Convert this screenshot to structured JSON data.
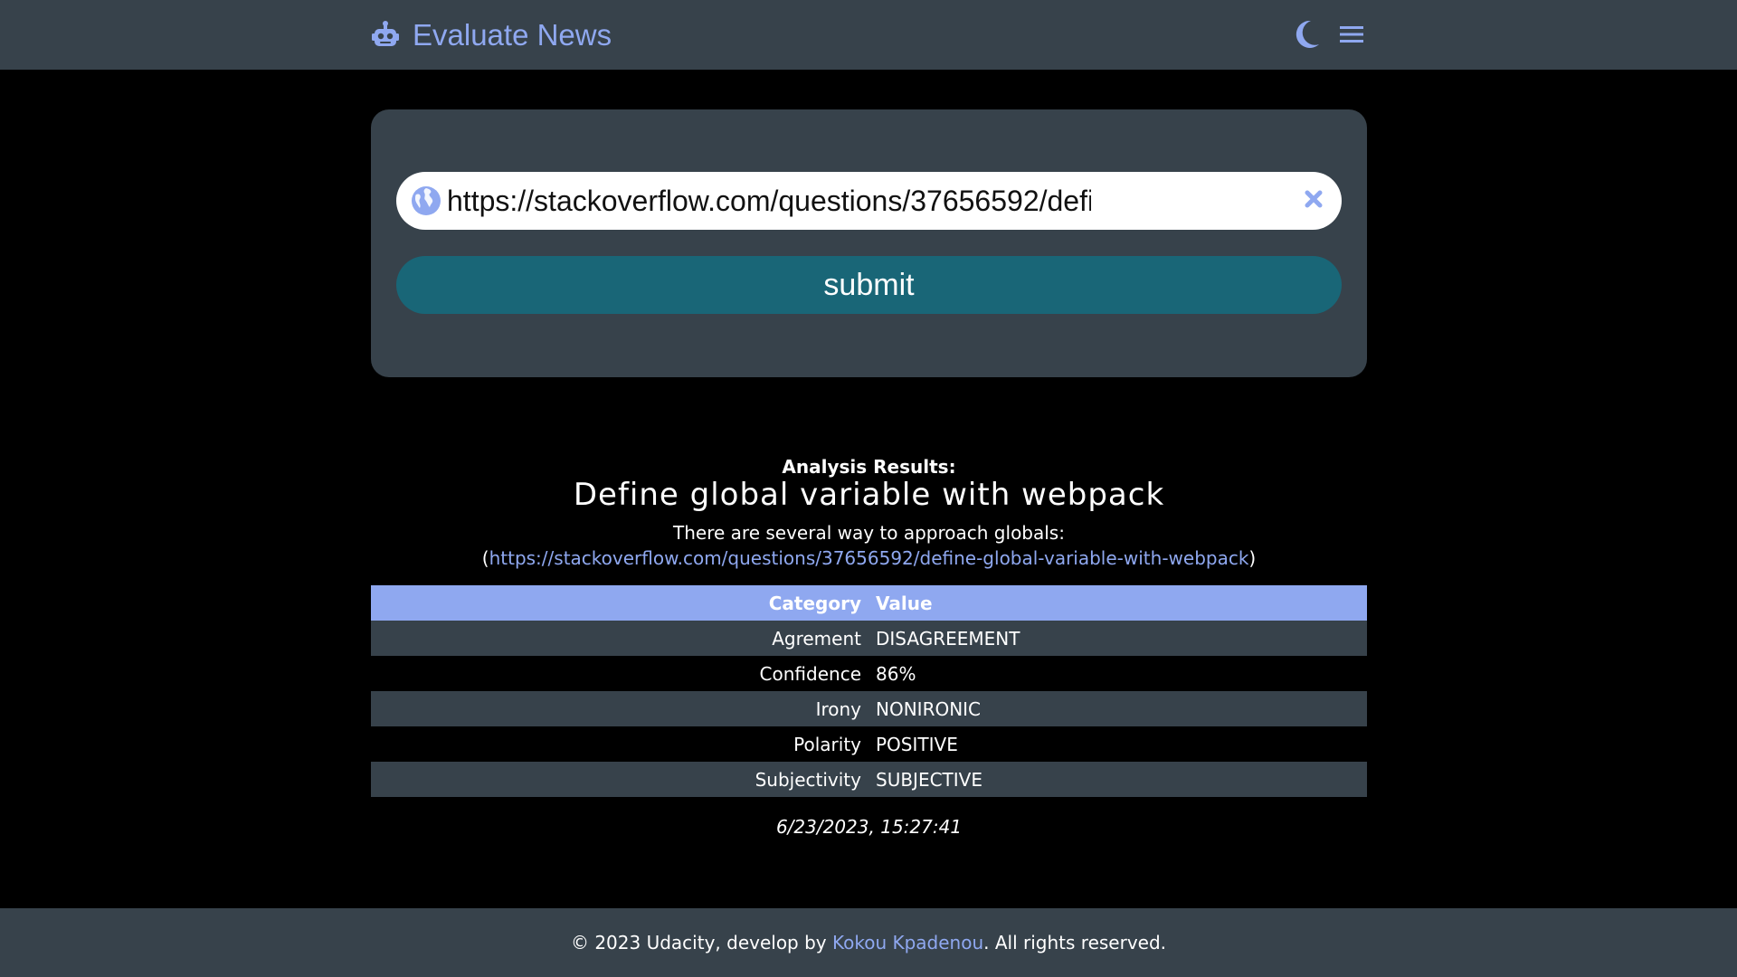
{
  "header": {
    "brand_title": "Evaluate News",
    "brand_icon": "robot-icon",
    "theme_toggle_icon": "moon-icon",
    "menu_icon": "hamburger-menu-icon"
  },
  "form": {
    "url_value": "https://stackoverflow.com/questions/37656592/define-global-variable-with-webpack",
    "url_icon": "globe-icon",
    "clear_icon": "close-icon",
    "submit_label": "submit"
  },
  "results": {
    "label": "Analysis Results:",
    "title": "Define global variable with webpack",
    "summary": "There are several way to approach globals:",
    "link_prefix": "(",
    "link_text": "https://stackoverflow.com/questions/37656592/define-global-variable-with-webpack",
    "link_suffix": ")",
    "table": {
      "headers": {
        "category": "Category",
        "value": "Value"
      },
      "rows": [
        {
          "category": "Agrement",
          "value": "DISAGREEMENT"
        },
        {
          "category": "Confidence",
          "value": "86%"
        },
        {
          "category": "Irony",
          "value": "NONIRONIC"
        },
        {
          "category": "Polarity",
          "value": "POSITIVE"
        },
        {
          "category": "Subjectivity",
          "value": "SUBJECTIVE"
        }
      ]
    },
    "timestamp": "6/23/2023, 15:27:41"
  },
  "footer": {
    "text_before": "© 2023 Udacity, develop by ",
    "author": "Kokou Kpadenou",
    "text_after": ". All rights reserved."
  },
  "colors": {
    "accent": "#8fa8f0",
    "bar_background": "#37424b",
    "submit_button": "#196677",
    "page_background": "#000000"
  }
}
